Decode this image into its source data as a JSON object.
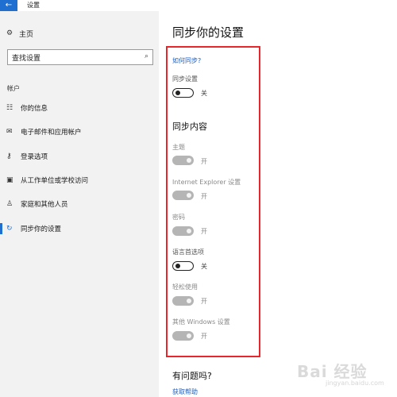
{
  "window": {
    "title": "设置"
  },
  "sidebar": {
    "home_label": "主页",
    "search_placeholder": "查找设置",
    "section_label": "帐户",
    "items": [
      {
        "label": "你的信息",
        "icon": "person-card-icon"
      },
      {
        "label": "电子邮件和应用帐户",
        "icon": "mail-icon"
      },
      {
        "label": "登录选项",
        "icon": "key-icon"
      },
      {
        "label": "从工作单位或学校访问",
        "icon": "briefcase-icon"
      },
      {
        "label": "家庭和其他人员",
        "icon": "person-icon"
      },
      {
        "label": "同步你的设置",
        "icon": "sync-icon",
        "active": true
      }
    ]
  },
  "main": {
    "title": "同步你的设置",
    "how_to_sync_link": "如何同步?",
    "sync_settings": {
      "label": "同步设置",
      "state": "关",
      "on": false
    },
    "sync_content_heading": "同步内容",
    "sync_items": [
      {
        "label": "主题",
        "state": "开",
        "on": true,
        "disabled": true
      },
      {
        "label": "Internet Explorer 设置",
        "state": "开",
        "on": true,
        "disabled": true
      },
      {
        "label": "密码",
        "state": "开",
        "on": true,
        "disabled": true
      },
      {
        "label": "语言首选项",
        "state": "关",
        "on": false,
        "disabled": false
      },
      {
        "label": "轻松使用",
        "state": "开",
        "on": true,
        "disabled": true
      },
      {
        "label": "其他 Windows 设置",
        "state": "开",
        "on": true,
        "disabled": true
      }
    ],
    "help_heading": "有问题吗?",
    "help_link": "获取帮助"
  },
  "colors": {
    "accent": "#1e6fd0",
    "highlight_box": "#e8272c"
  },
  "watermark": {
    "text": "Bai 经验",
    "sub": "jingyan.baidu.com"
  }
}
